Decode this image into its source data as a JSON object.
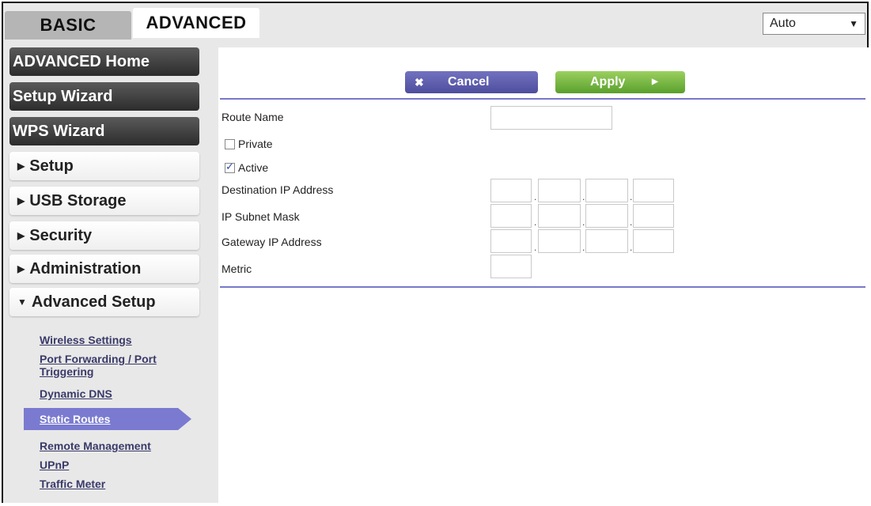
{
  "tabs": {
    "basic": "BASIC",
    "advanced": "ADVANCED"
  },
  "language": {
    "selected": "Auto"
  },
  "sidebar": {
    "dark": [
      "ADVANCED Home",
      "Setup Wizard",
      "WPS Wizard"
    ],
    "sections": [
      "Setup",
      "USB Storage",
      "Security",
      "Administration",
      "Advanced Setup"
    ],
    "sublinks": [
      "Wireless Settings",
      "Port Forwarding / Port Triggering",
      "Dynamic DNS",
      "Static Routes",
      "Remote Management",
      "UPnP",
      "Traffic Meter"
    ],
    "active_sublink": "Static Routes"
  },
  "actions": {
    "cancel": "Cancel",
    "apply": "Apply"
  },
  "form": {
    "route_name": "Route Name",
    "private": "Private",
    "private_checked": false,
    "active": "Active",
    "active_checked": true,
    "destination_ip": "Destination IP Address",
    "subnet_mask": "IP Subnet Mask",
    "gateway_ip": "Gateway IP Address",
    "metric": "Metric"
  }
}
